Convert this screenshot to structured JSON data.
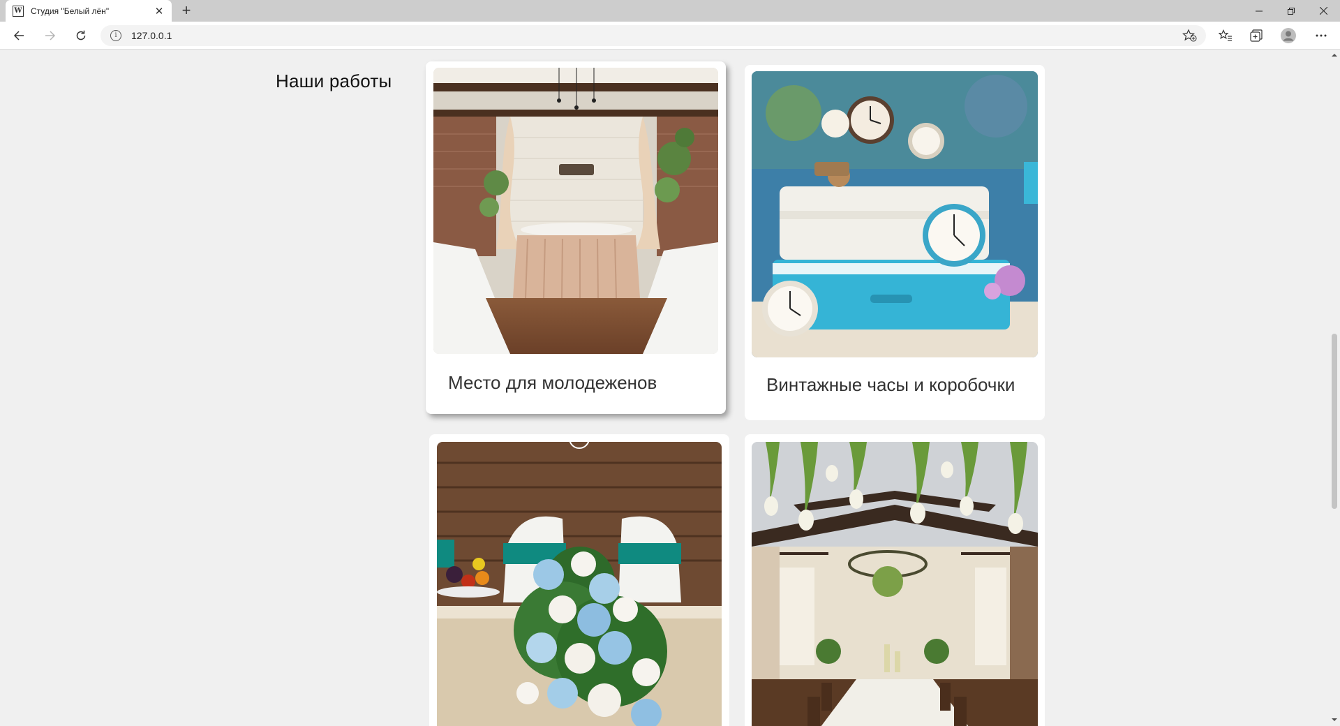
{
  "browser": {
    "tab": {
      "title": "Студия \"Белый лён\"",
      "favicon": "W",
      "close": "✕"
    },
    "new_tab": "+",
    "url": "127.0.0.1"
  },
  "page": {
    "section_title": "Наши работы",
    "cards": [
      {
        "caption": "Место для молодеженов",
        "image": "wedding hall with white curtains and presidium table"
      },
      {
        "caption": "Винтажные часы и коробочки",
        "image": "vintage clocks on turquoise suitcases with flowers"
      },
      {
        "caption": "",
        "image": "blue and white flower arrangement on wooden backdrop"
      },
      {
        "caption": "",
        "image": "banquet hall with hanging tulips and chandelier"
      }
    ]
  },
  "colors": {
    "page_bg": "#f0f0f0",
    "card_bg": "#ffffff",
    "tabbar_bg": "#cdcdcd"
  }
}
